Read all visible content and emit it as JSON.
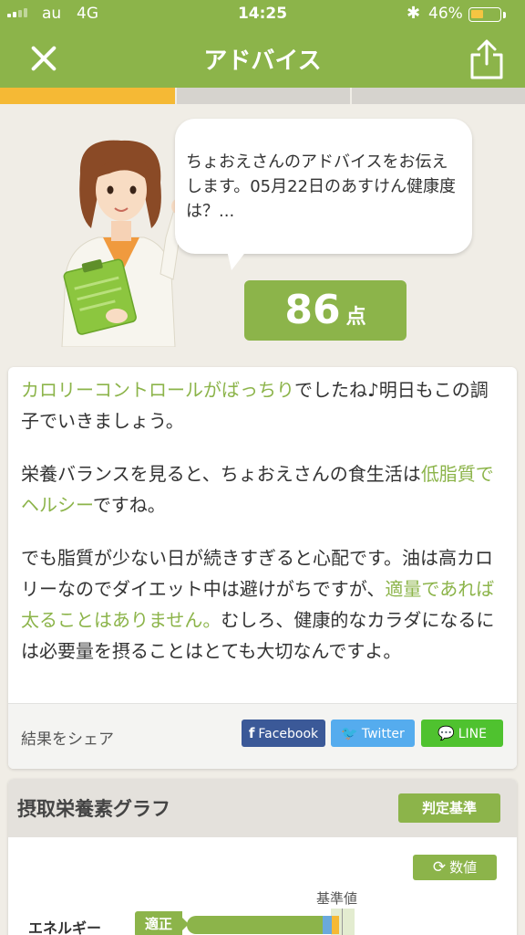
{
  "status_bar": {
    "carrier": "au",
    "network": "4G",
    "time": "14:25",
    "battery_percent": "46%",
    "battery_level": 0.46,
    "bluetooth_icon": "bluetooth-icon"
  },
  "nav": {
    "title": "アドバイス",
    "close_icon": "close-icon",
    "share_icon": "share-icon"
  },
  "progress": {
    "segments": 3,
    "active": 1
  },
  "advisor": {
    "speech": "ちょおえさんのアドバイスをお伝えします。05月22日のあすけん健康度は？...",
    "score": "86",
    "score_unit": "点"
  },
  "advice": {
    "p1_highlight": "カロリーコントロールがばっちり",
    "p1_rest": "でしたね♪明日もこの調子でいきましょう。",
    "p2_start": "栄養バランスを見ると、ちょおえさんの食生活は",
    "p2_highlight": "低脂質でヘルシー",
    "p2_end": "ですね。",
    "p3_start": "でも脂質が少ない日が続きすぎると心配です。油は高カロリーなのでダイエット中は避けがちですが、",
    "p3_highlight": "適量であれば太ることはありません。",
    "p3_end": "むしろ、健康的なカラダになるには必要量を摂ることはとても大切なんですよ。"
  },
  "share": {
    "label": "結果をシェア",
    "facebook": "Facebook",
    "twitter": "Twitter",
    "line": "LINE"
  },
  "graph": {
    "title": "摂取栄養素グラフ",
    "criteria_button": "判定基準",
    "value_button": "数値",
    "reference_label": "基準値",
    "rows": [
      {
        "name": "エネルギー",
        "judgement": "適正",
        "ratio_to_reference": 0.98
      }
    ]
  },
  "colors": {
    "brand_green": "#8cb44a",
    "accent_orange": "#f5b935",
    "facebook": "#3b5998",
    "twitter": "#55acee",
    "line": "#4fc22f"
  }
}
